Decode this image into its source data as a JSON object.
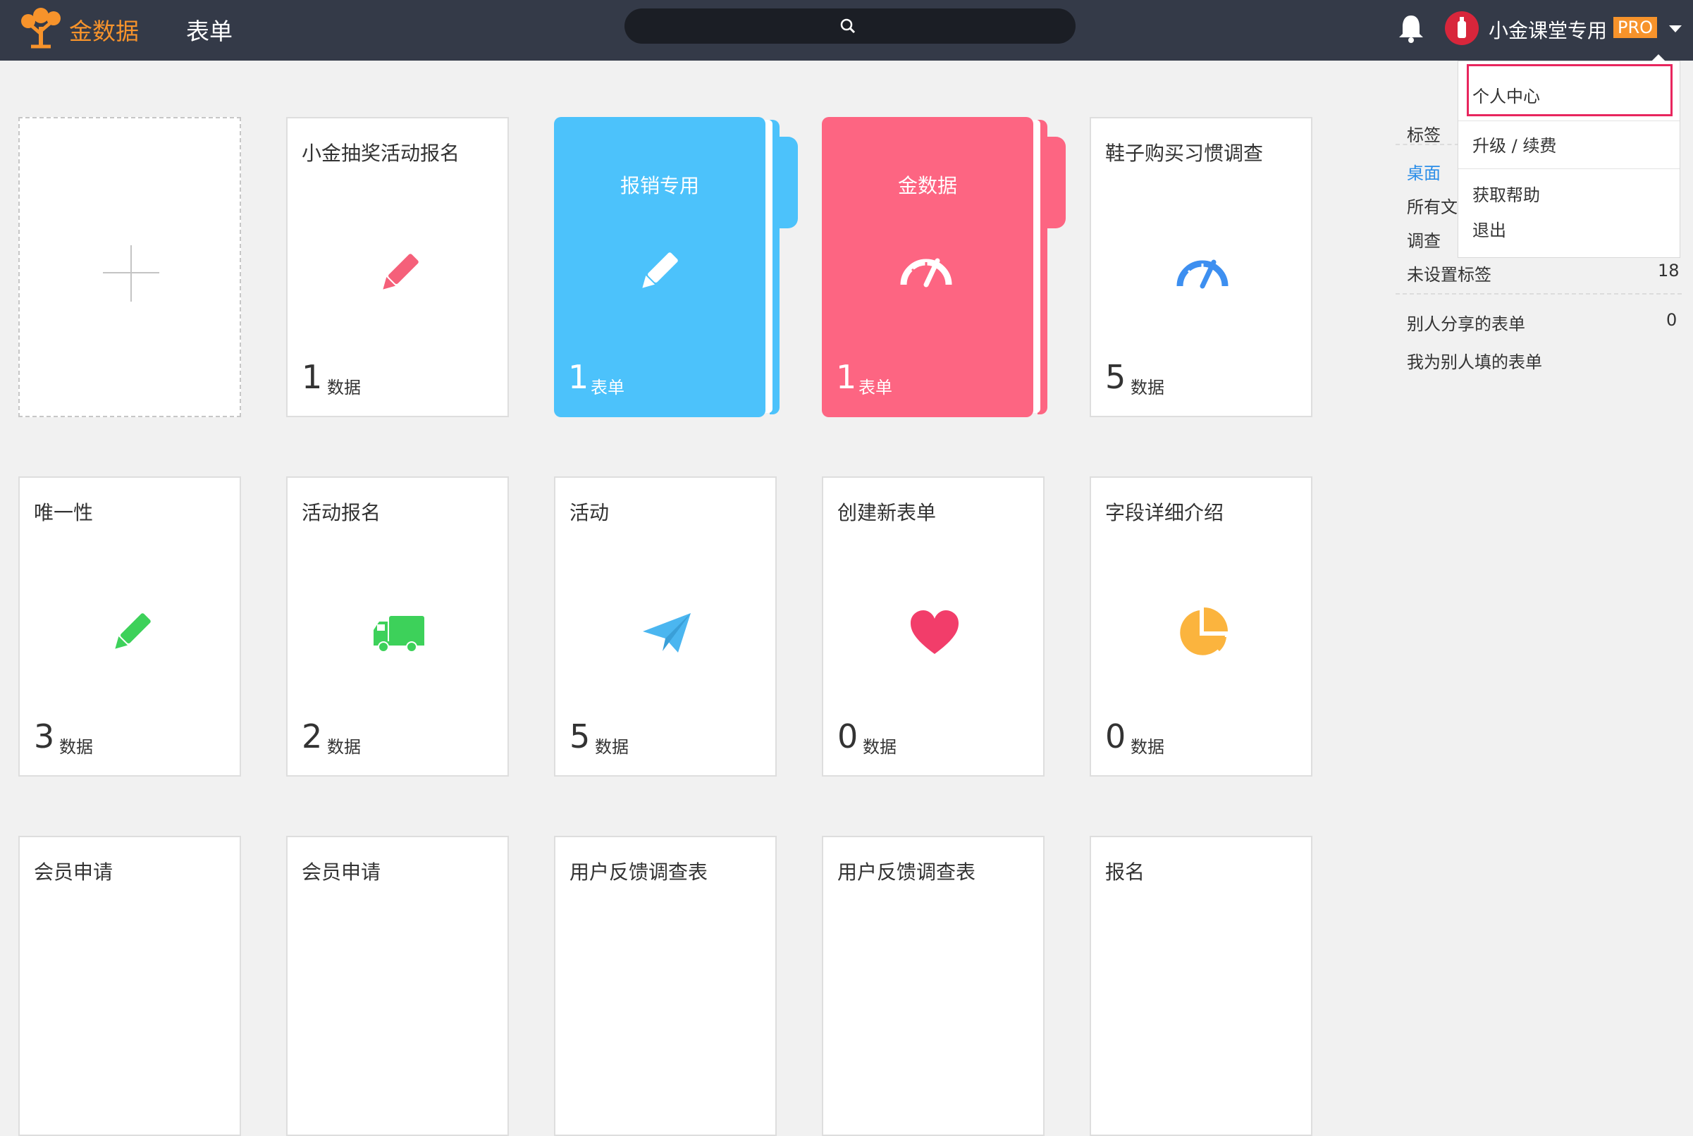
{
  "topbar": {
    "brand": "金数据",
    "nav_forms": "表单",
    "username": "小金课堂专用",
    "plan_badge": "PRO",
    "icons": {
      "logo": "tree-logo-icon",
      "search": "search-icon",
      "bell": "bell-icon",
      "avatar": "avatar-icon",
      "menu": "caret-down-icon"
    }
  },
  "add_card": {
    "icon": "plus-icon"
  },
  "cards": [
    {
      "title": "小金抽奖活动报名",
      "count": "1",
      "unit": "数据",
      "icon": "pencil-icon",
      "color": "#f5607a"
    },
    {
      "title": "报销专用",
      "count": "1",
      "unit": "表单",
      "icon": "pencil-icon",
      "folder": true,
      "color": "#4cc2fb",
      "icon_color": "#ffffff"
    },
    {
      "title": "金数据",
      "count": "1",
      "unit": "表单",
      "icon": "gauge-icon",
      "folder": true,
      "color": "#fd6582",
      "icon_color": "#ffffff"
    },
    {
      "title": "鞋子购买习惯调查",
      "count": "5",
      "unit": "数据",
      "icon": "gauge-icon",
      "color": "#3d8ff0"
    },
    {
      "title": "唯一性",
      "count": "3",
      "unit": "数据",
      "icon": "pencil-icon",
      "color": "#3dd15a"
    },
    {
      "title": "活动报名",
      "count": "2",
      "unit": "数据",
      "icon": "truck-icon",
      "color": "#3dd15a"
    },
    {
      "title": "活动",
      "count": "5",
      "unit": "数据",
      "icon": "paper-plane-icon",
      "color": "#4bb6f0"
    },
    {
      "title": "创建新表单",
      "count": "0",
      "unit": "数据",
      "icon": "heart-icon",
      "color": "#f23d6a"
    },
    {
      "title": "字段详细介绍",
      "count": "0",
      "unit": "数据",
      "icon": "pie-chart-icon",
      "color": "#fbb43e"
    },
    {
      "title": "会员申请"
    },
    {
      "title": "会员申请"
    },
    {
      "title": "用户反馈调查表"
    },
    {
      "title": "用户反馈调查表"
    },
    {
      "title": "报名"
    }
  ],
  "side": {
    "header": "标签",
    "items": [
      "桌面",
      "所有文",
      "调查"
    ],
    "untagged_label": "未设置标签",
    "untagged_count": "18",
    "shared_label": "别人分享的表单",
    "shared_count": "0",
    "filled_label": "我为别人填的表单",
    "active_color": "#2a8de8"
  },
  "dropdown": {
    "items": [
      "个人中心",
      "升级 / 续费",
      "获取帮助",
      "退出"
    ],
    "highlight_color": "#e8265e"
  }
}
